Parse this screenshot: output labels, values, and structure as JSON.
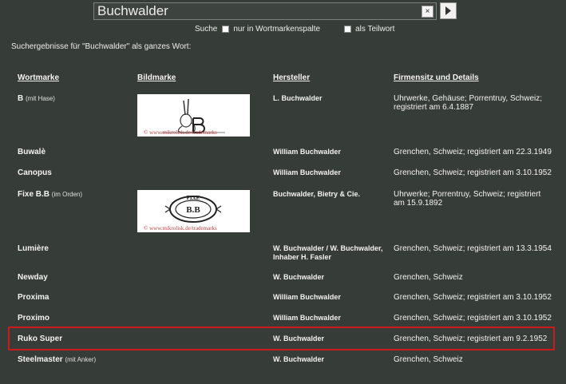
{
  "search": {
    "query": "Buchwalder",
    "clear_label": "×"
  },
  "options": {
    "search_label": "Suche",
    "only_column_label": "nur in Wortmarkenspalte",
    "partial_label": "als Teilwort"
  },
  "result_caption": "Suchergebnisse für \"Buchwalder\" als ganzes Wort:",
  "columns": {
    "wortmarke": "Wortmarke",
    "bildmarke": "Bildmarke",
    "hersteller": "Hersteller",
    "firmensitz": "Firmensitz und Details"
  },
  "rows": [
    {
      "mark": "B",
      "note": "(mit Hase)",
      "maker": "L. Buchwalder",
      "details": "Uhrwerke, Gehäuse; Porrentruy, Schweiz; registriert am 6.4.1887",
      "logo": "hare",
      "watermark": "© www.mikrolisk.de/trademarks"
    },
    {
      "mark": "Buwalè",
      "note": "",
      "maker": "William Buchwalder",
      "details": "Grenchen, Schweiz; registriert am 22.3.1949"
    },
    {
      "mark": "Canopus",
      "note": "",
      "maker": "William Buchwalder",
      "details": "Grenchen, Schweiz; registriert am 3.10.1952"
    },
    {
      "mark": "Fixe B.B",
      "note": "(im Orden)",
      "maker": "Buchwalder, Bietry & Cie.",
      "details": "Uhrwerke; Porrentruy, Schweiz; registriert am 15.9.1892",
      "logo": "badge",
      "logo_text_top": "FIXE",
      "logo_text_mid": "B.B",
      "watermark": "© www.mikrolisk.de/trademarks"
    },
    {
      "mark": "Lumière",
      "note": "",
      "maker": "W. Buchwalder / W. Buchwalder, Inhaber H. Fasler",
      "details": "Grenchen, Schweiz; registriert am 13.3.1954"
    },
    {
      "mark": "Newday",
      "note": "",
      "maker": "W. Buchwalder",
      "details": "Grenchen, Schweiz"
    },
    {
      "mark": "Proxima",
      "note": "",
      "maker": "William Buchwalder",
      "details": "Grenchen, Schweiz; registriert am 3.10.1952"
    },
    {
      "mark": "Proximo",
      "note": "",
      "maker": "William Buchwalder",
      "details": "Grenchen, Schweiz; registriert am 3.10.1952"
    },
    {
      "mark": "Ruko Super",
      "note": "",
      "maker": "W. Buchwalder",
      "details": "Grenchen, Schweiz; registriert am 9.2.1952",
      "highlighted": true
    },
    {
      "mark": "Steelmaster",
      "note": "(mit Anker)",
      "maker": "W. Buchwalder",
      "details": "Grenchen, Schweiz"
    }
  ],
  "colors": {
    "background": "#363c37",
    "highlight": "#cc1a1a"
  },
  "icons": {
    "go": "play-triangle-icon",
    "clear": "close-icon"
  }
}
